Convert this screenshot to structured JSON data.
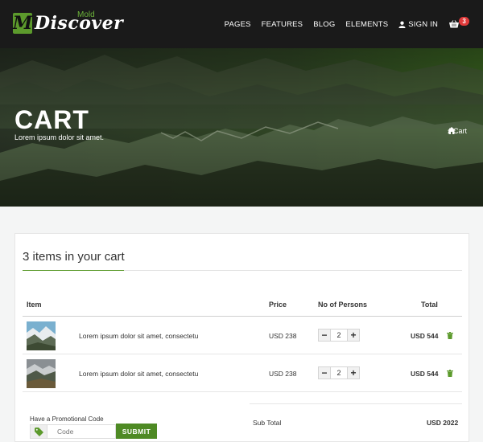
{
  "brand": {
    "mark": "M",
    "name": "Discover",
    "sub": "Mold"
  },
  "nav": {
    "items": [
      "PAGES",
      "FEATURES",
      "BLOG",
      "ELEMENTS"
    ],
    "sign_in": "SIGN IN",
    "cart_count": "3"
  },
  "hero": {
    "title": "CART",
    "subtitle": "Lorem ipsum dolor sit amet.",
    "breadcrumb_sep": "/",
    "breadcrumb_current": "Cart"
  },
  "cart": {
    "heading": "3 items in your cart",
    "columns": {
      "item": "Item",
      "price": "Price",
      "persons": "No of Persons",
      "total": "Total"
    },
    "rows": [
      {
        "desc": "Lorem ipsum dolor sit amet, consectetu",
        "price": "USD 238",
        "qty": "2",
        "total": "USD 544"
      },
      {
        "desc": "Lorem ipsum dolor sit amet, consectetu",
        "price": "USD 238",
        "qty": "2",
        "total": "USD 544"
      }
    ],
    "minus": "−",
    "plus": "+"
  },
  "promo": {
    "label": "Have a Promotional Code",
    "placeholder": "Code",
    "submit": "SUBMIT"
  },
  "summary": {
    "subtotal_label": "Sub Total",
    "subtotal_value": "USD 2022"
  },
  "colors": {
    "accent": "#5c9a2c",
    "badge": "#e03a3a",
    "nav_bg": "#1a1a1a"
  }
}
